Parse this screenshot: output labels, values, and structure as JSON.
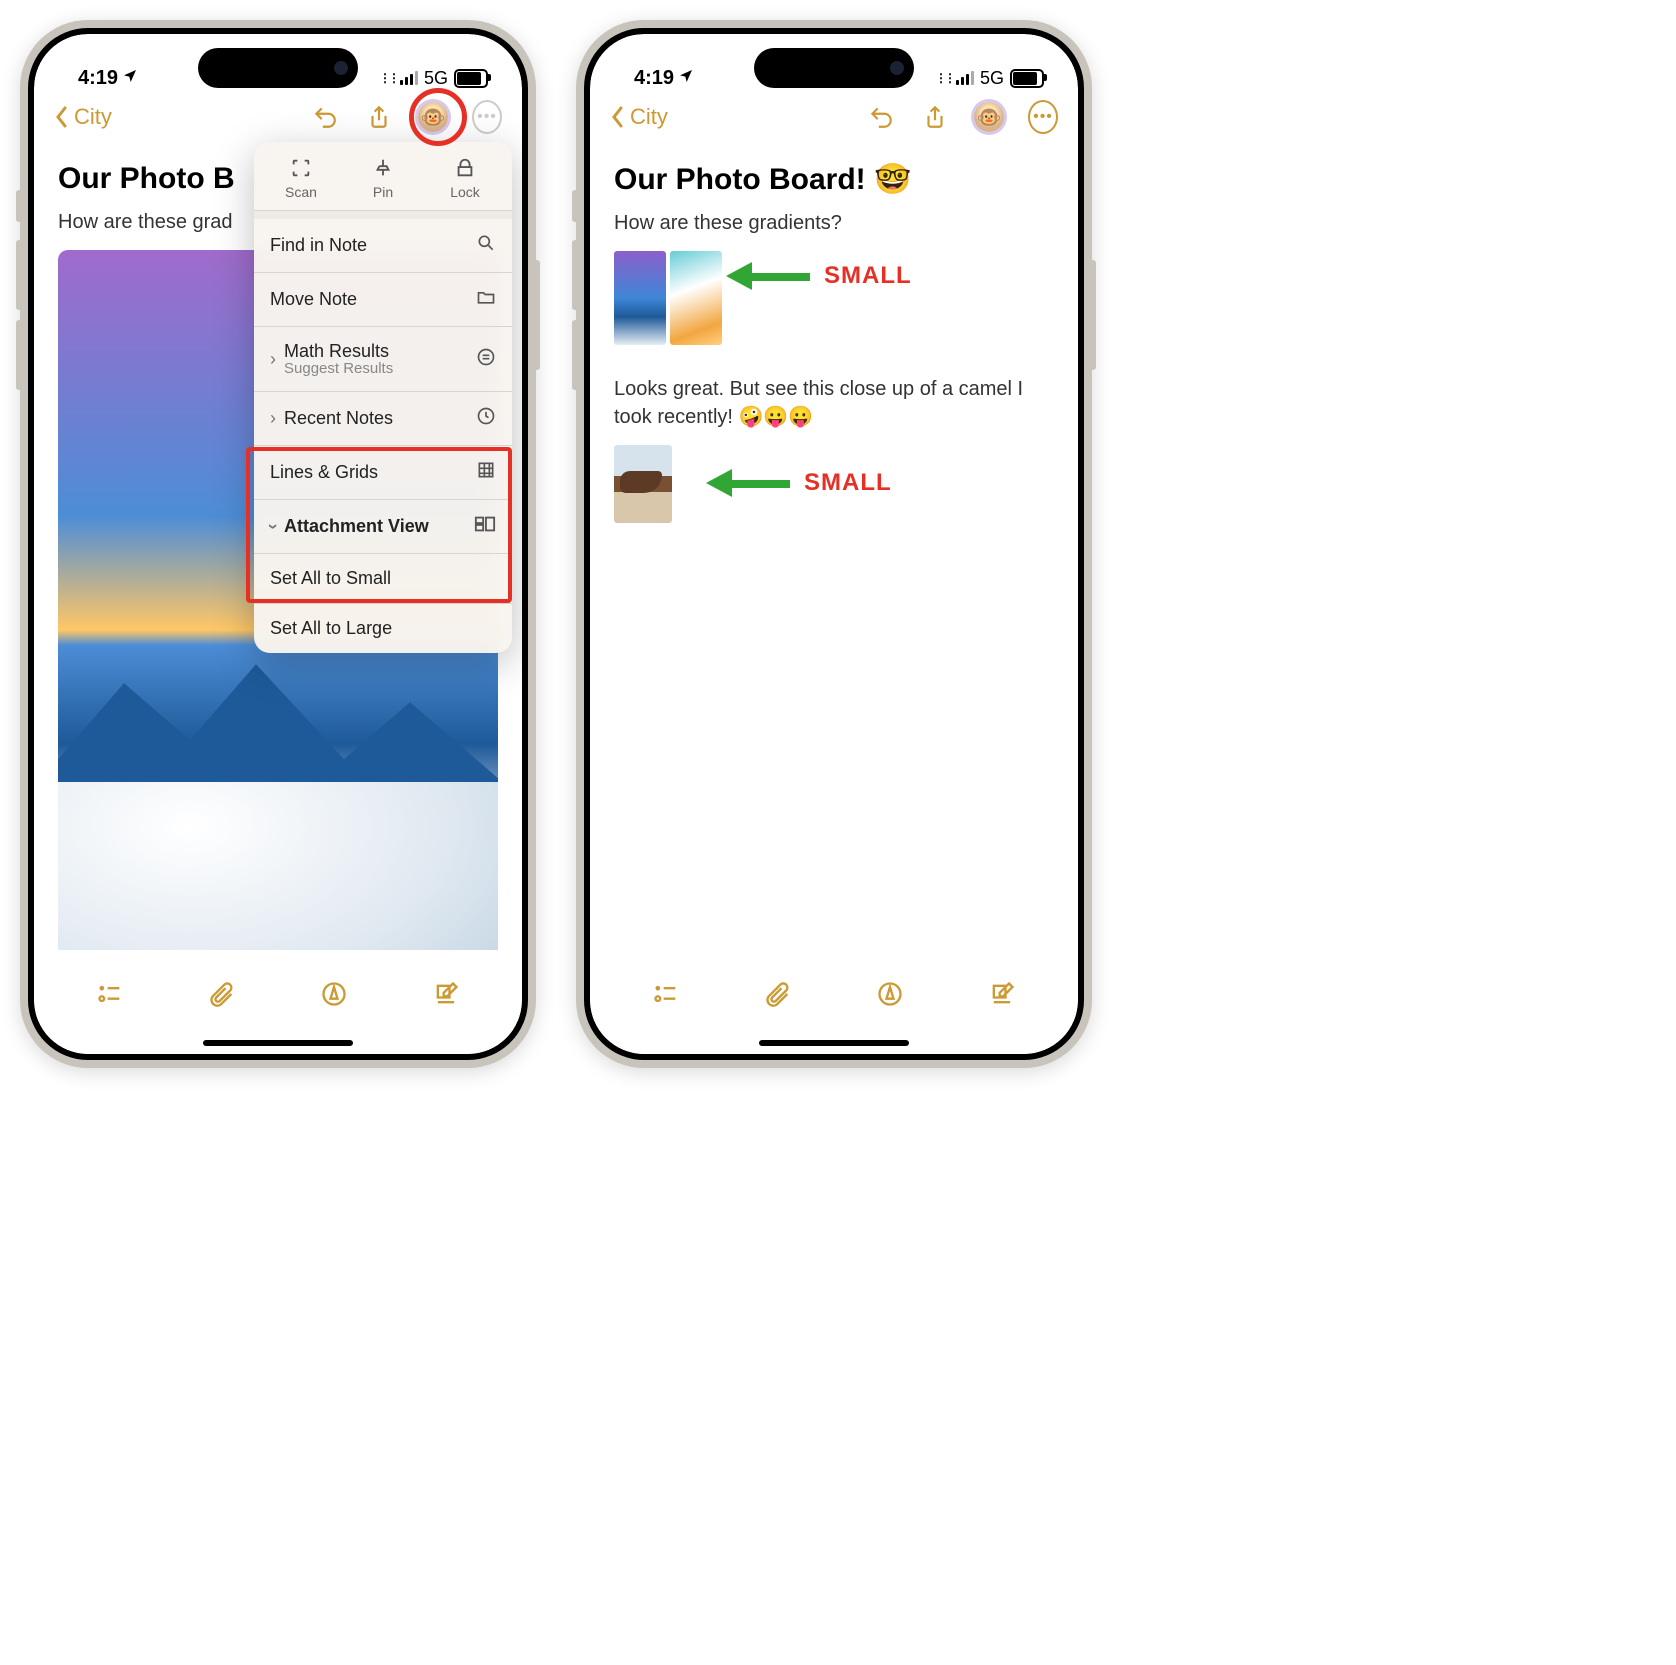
{
  "status": {
    "time": "4:19",
    "network": "5G"
  },
  "nav": {
    "back_label": "City"
  },
  "note": {
    "title_left": "Our Photo B",
    "title_full": "Our Photo Board! 🤓",
    "body_line1_left": "How are these grad",
    "body_line1_full": "How are these gradients?",
    "body_para2": "Looks great. But see this close up of a camel I took recently! 🤪😛😛"
  },
  "menu": {
    "top": {
      "scan": "Scan",
      "pin": "Pin",
      "lock": "Lock"
    },
    "find": "Find in Note",
    "move": "Move Note",
    "math": "Math Results",
    "math_sub": "Suggest Results",
    "recent": "Recent Notes",
    "lines": "Lines & Grids",
    "attach": "Attachment View",
    "set_small": "Set All to Small",
    "set_large": "Set All to Large"
  },
  "annotations": {
    "small_label": "SMALL"
  }
}
